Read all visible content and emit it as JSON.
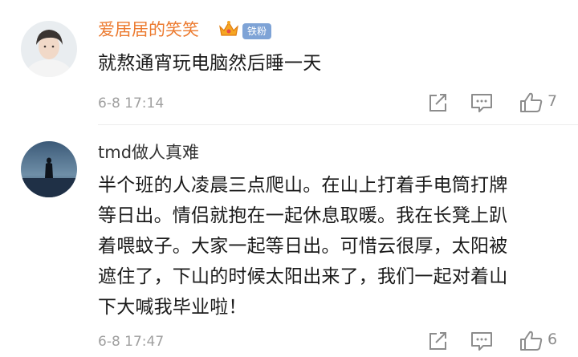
{
  "comments": [
    {
      "username": "爱居居的笑笑",
      "badge": "铁粉",
      "content_lines": [
        "就熬通宵玩电脑然后睡一天"
      ],
      "timestamp": "6-8 17:14",
      "like_count": "7",
      "username_color": "#ec7a2f"
    },
    {
      "username": "tmd做人真难",
      "content_lines": [
        "半个班的人凌晨三点爬山。在山上打着手电筒打牌",
        "等日出。情侣就抱在一起休息取暖。我在长凳上趴",
        "着喂蚊子。大家一起等日出。可惜云很厚，太阳被",
        "遮住了，下山的时候太阳出来了，我们一起对着山",
        "下大喊我毕业啦！"
      ],
      "timestamp": "6-8 17:47",
      "like_count": "6"
    }
  ],
  "icons": {
    "share": "share-icon",
    "reply": "comment-icon",
    "like": "thumbs-up-icon",
    "crown": "crown-icon"
  }
}
